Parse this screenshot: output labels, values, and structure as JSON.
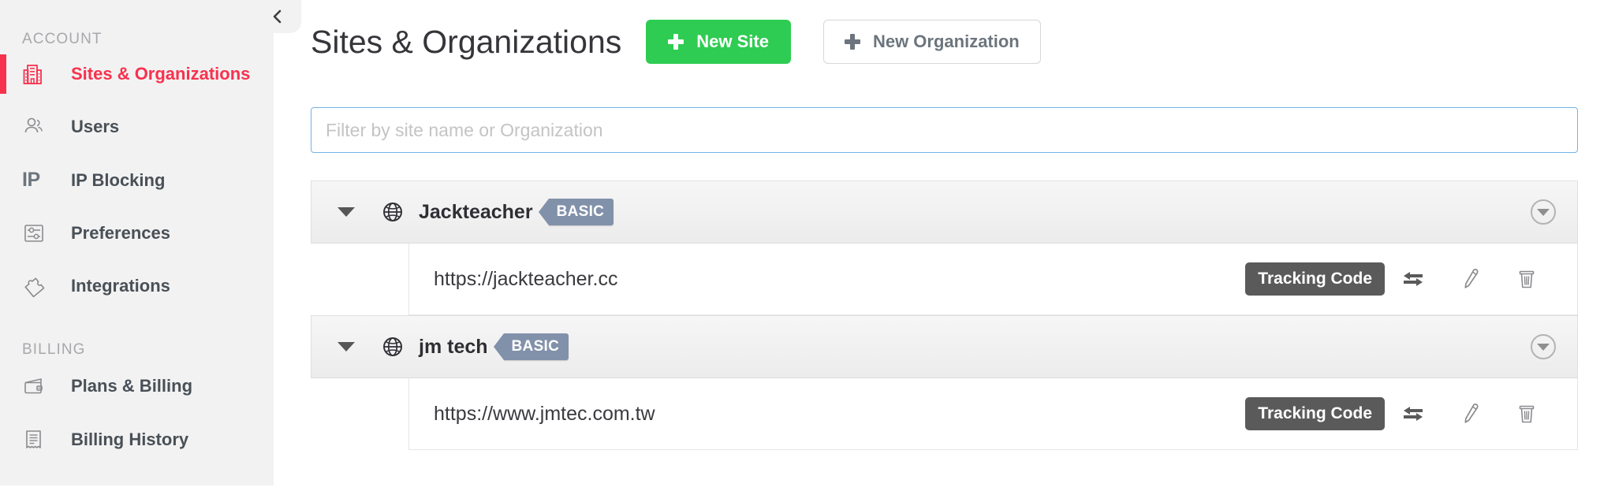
{
  "sidebar": {
    "collapse_icon": "chevron-left-icon",
    "sections": [
      {
        "label": "ACCOUNT",
        "items": [
          {
            "label": "Sites & Organizations",
            "icon": "building-icon",
            "active": true
          },
          {
            "label": "Users",
            "icon": "users-icon",
            "active": false
          },
          {
            "label": "IP Blocking",
            "icon": "ip-icon",
            "active": false
          },
          {
            "label": "Preferences",
            "icon": "sliders-icon",
            "active": false
          },
          {
            "label": "Integrations",
            "icon": "puzzle-icon",
            "active": false
          }
        ]
      },
      {
        "label": "BILLING",
        "items": [
          {
            "label": "Plans & Billing",
            "icon": "wallet-icon",
            "active": false
          },
          {
            "label": "Billing History",
            "icon": "receipt-icon",
            "active": false
          }
        ]
      }
    ]
  },
  "header": {
    "title": "Sites & Organizations",
    "new_site_label": "New Site",
    "new_org_label": "New Organization"
  },
  "filter": {
    "value": "",
    "placeholder": "Filter by site name or Organization"
  },
  "organizations": [
    {
      "name": "Jackteacher",
      "plan": "BASIC",
      "expanded": true,
      "sites": [
        {
          "url": "https://jackteacher.cc",
          "tracking_code_label": "Tracking Code",
          "actions": [
            "transfer-icon",
            "edit-pencil-icon",
            "trash-icon"
          ]
        }
      ]
    },
    {
      "name": "jm tech",
      "plan": "BASIC",
      "expanded": true,
      "sites": [
        {
          "url": "https://www.jmtec.com.tw",
          "tracking_code_label": "Tracking Code",
          "actions": [
            "transfer-icon",
            "edit-pencil-icon",
            "trash-icon"
          ]
        }
      ]
    }
  ],
  "colors": {
    "accent_red": "#f8314e",
    "primary_green": "#2ecc52",
    "badge_blue_gray": "#8291aa",
    "tracking_code_gray": "#5a5a5a",
    "sidebar_bg": "#f2f2f2",
    "focus_border": "#73b3e8"
  }
}
